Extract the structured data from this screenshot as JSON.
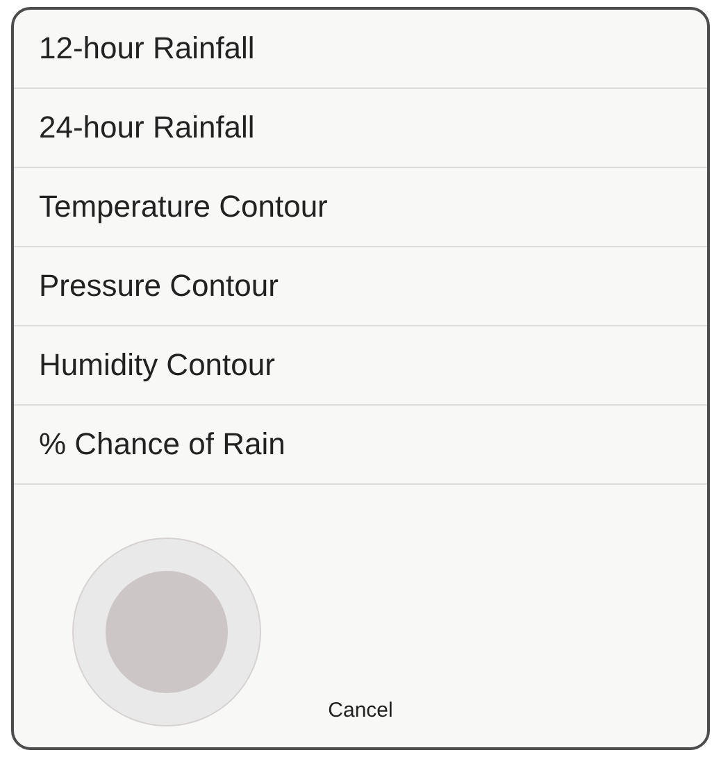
{
  "menu": {
    "items": [
      {
        "label": "12-hour Rainfall"
      },
      {
        "label": "24-hour Rainfall"
      },
      {
        "label": "Temperature Contour"
      },
      {
        "label": "Pressure Contour"
      },
      {
        "label": "Humidity Contour"
      },
      {
        "label": "% Chance of Rain"
      }
    ],
    "cancel": "Cancel"
  }
}
